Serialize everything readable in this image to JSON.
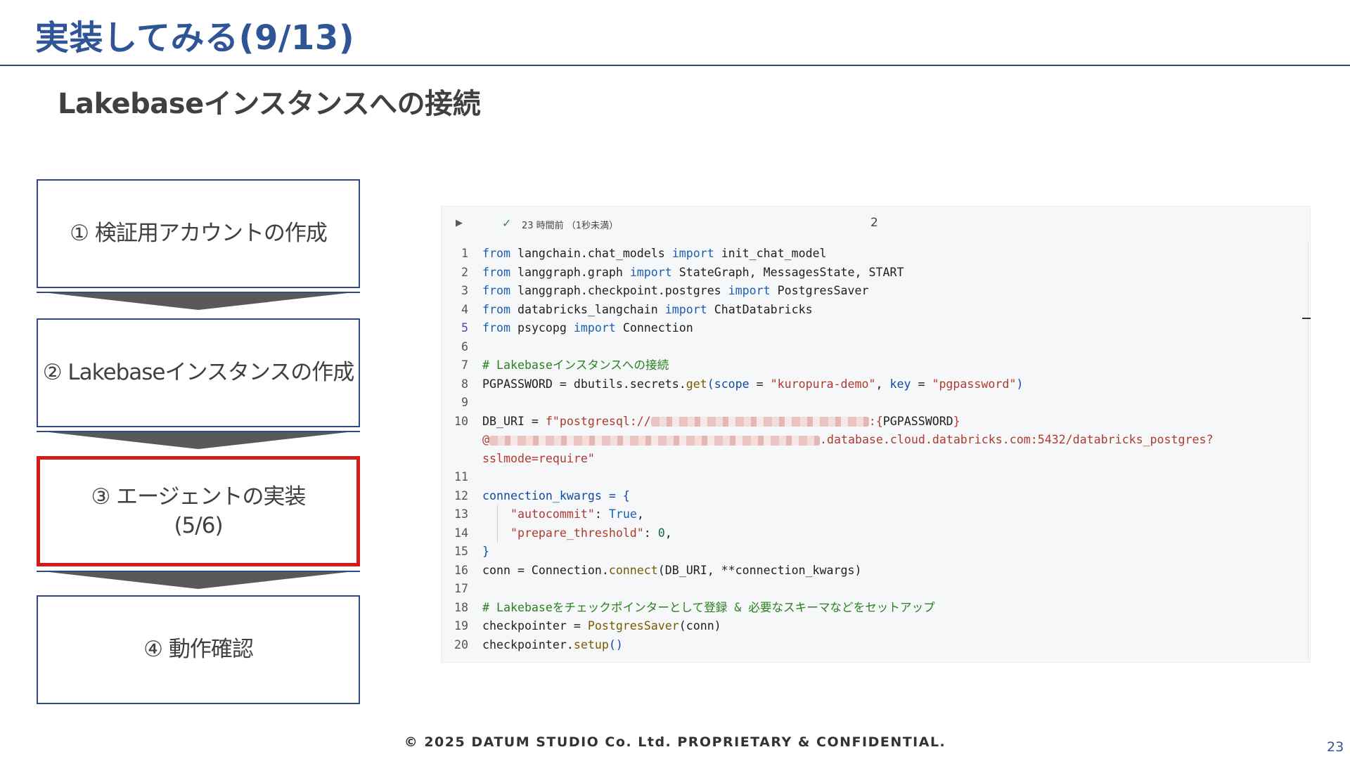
{
  "slide": {
    "title": "実装してみる(9/13)",
    "subtitle": "Lakebaseインスタンスへの接続",
    "footer": "© 2025 DATUM STUDIO Co. Ltd. PROPRIETARY & CONFIDENTIAL.",
    "page_number": "23"
  },
  "steps": [
    {
      "line1": "① 検証用アカウントの作成"
    },
    {
      "line1": "② Lakebaseインスタンスの作成"
    },
    {
      "line1": "③ エージェントの実装",
      "line2": "(5/6)",
      "active": true
    },
    {
      "line1": "④ 動作確認"
    }
  ],
  "cell": {
    "run_icon": "play-icon",
    "status_icon": "check-icon",
    "status_text": "23 時間前 （1秒未満）",
    "cell_count": "2",
    "lines": [
      {
        "n": "1",
        "parts": [
          "from",
          " langchain.chat_models ",
          "import",
          " init_chat_model"
        ]
      },
      {
        "n": "2",
        "parts": [
          "from",
          " langgraph.graph ",
          "import",
          " StateGraph, MessagesState, START"
        ]
      },
      {
        "n": "3",
        "parts": [
          "from",
          " langgraph.checkpoint.postgres ",
          "import",
          " PostgresSaver"
        ]
      },
      {
        "n": "4",
        "parts": [
          "from",
          " databricks_langchain ",
          "import",
          " ChatDatabricks"
        ]
      },
      {
        "n": "5",
        "parts": [
          "from",
          " psycopg ",
          "import",
          " Connection"
        ]
      },
      {
        "n": "6"
      },
      {
        "n": "7",
        "comment": "# Lakebaseインスタンスへの接続"
      },
      {
        "n": "8",
        "parts": [
          "PGPASSWORD = dbutils.secrets.",
          "get",
          "(",
          "scope",
          " = ",
          "\"kuropura-demo\"",
          ", ",
          "key",
          " = ",
          "\"pgpassword\"",
          ")"
        ]
      },
      {
        "n": "9"
      },
      {
        "n": "10",
        "parts": [
          "DB_URI = ",
          "f\"postgresql://",
          ":{",
          "PGPASSWORD",
          "}"
        ]
      },
      {
        "cont": "@",
        "tail": ".database.cloud.databricks.com:5432/databricks_postgres?"
      },
      {
        "cont2": "sslmode=require\""
      },
      {
        "n": "11"
      },
      {
        "n": "12",
        "parts": [
          "connection_kwargs = {"
        ]
      },
      {
        "n": "13",
        "parts": [
          "\"autocommit\"",
          ": ",
          "True",
          ","
        ]
      },
      {
        "n": "14",
        "parts": [
          "\"prepare_threshold\"",
          ": ",
          "0",
          ","
        ]
      },
      {
        "n": "15",
        "parts": [
          "}"
        ]
      },
      {
        "n": "16",
        "parts": [
          "conn = Connection.",
          "connect",
          "(DB_URI, **connection_kwargs)"
        ]
      },
      {
        "n": "17"
      },
      {
        "n": "18",
        "comment": "# Lakebaseをチェックポインターとして登録 & 必要なスキーマなどをセットアップ"
      },
      {
        "n": "19",
        "parts": [
          "checkpointer = ",
          "PostgresSaver",
          "(conn)"
        ]
      },
      {
        "n": "20",
        "parts": [
          "checkpointer.",
          "setup",
          "()"
        ]
      }
    ]
  },
  "colors": {
    "title": "#2f5597",
    "active_border": "#d51a1a",
    "step_border": "#2f4a85"
  }
}
